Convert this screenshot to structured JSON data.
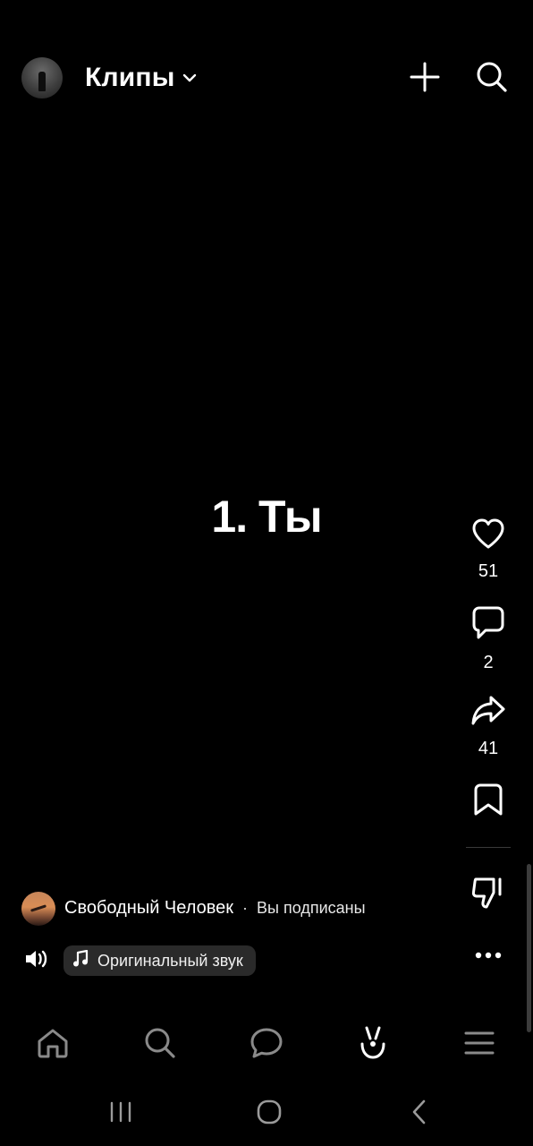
{
  "header": {
    "title": "Клипы"
  },
  "clip": {
    "overlay_text": "1. Ты"
  },
  "actions": {
    "likes": "51",
    "comments": "2",
    "shares": "41"
  },
  "author": {
    "name": "Свободный Человек",
    "separator": "·",
    "status": "Вы подписаны"
  },
  "sound": {
    "label": "Оригинальный звук"
  },
  "icons": {
    "top": [
      "chevron-down-icon",
      "plus-icon",
      "search-icon"
    ],
    "actions": [
      "heart-icon",
      "comment-icon",
      "share-icon",
      "bookmark-icon",
      "dislike-icon",
      "more-icon"
    ],
    "bottom_nav": [
      "home-icon",
      "search-icon",
      "messages-icon",
      "clips-icon",
      "menu-icon"
    ],
    "system": [
      "recents-icon",
      "home-circle-icon",
      "back-icon"
    ]
  },
  "colors": {
    "background": "#000000",
    "text": "#ffffff",
    "pill": "#2a2a2a",
    "nav_inactive": "#8a8a8a"
  }
}
